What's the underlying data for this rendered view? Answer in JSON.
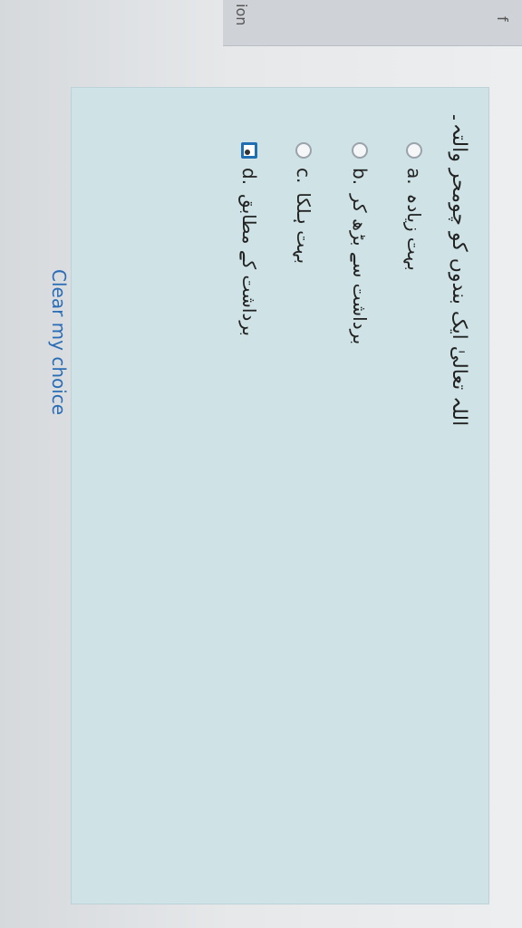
{
  "sidebar": {
    "label_top": "f",
    "label_bottom": "ion"
  },
  "question": {
    "text": "اللہ تعالیٰ ایک بندوں کو چومحر والتہ۔",
    "options": [
      {
        "letter": "a.",
        "text": "بہت زیادہ"
      },
      {
        "letter": "b.",
        "text": "برداشت سے بڑھ کر"
      },
      {
        "letter": "c.",
        "text": "بہت ہلکا"
      },
      {
        "letter": "d.",
        "text": "برداشت کے مطابق"
      }
    ],
    "selected": "d",
    "clear_label": "Clear my choice"
  },
  "colors": {
    "question_bg": "#cfe3e6",
    "link": "#2a6db6",
    "selected_border": "#1f6fb3"
  }
}
